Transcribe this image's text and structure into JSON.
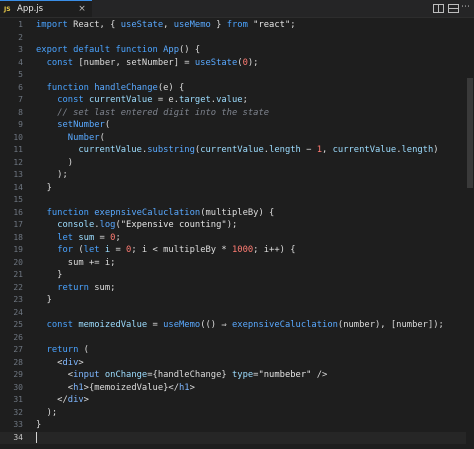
{
  "tab": {
    "icon_text": "JS",
    "filename": "App.js",
    "close": "×",
    "more": "⋯"
  },
  "lines": [
    [
      {
        "c": "kw",
        "t": "import"
      },
      {
        "c": "punc",
        "t": " React, { "
      },
      {
        "c": "fn",
        "t": "useState"
      },
      {
        "c": "punc",
        "t": ", "
      },
      {
        "c": "fn",
        "t": "useMemo"
      },
      {
        "c": "punc",
        "t": " } "
      },
      {
        "c": "kw",
        "t": "from"
      },
      {
        "c": "str",
        "t": " \"react\""
      },
      {
        "c": "punc",
        "t": ";"
      }
    ],
    [],
    [
      {
        "c": "kw",
        "t": "export default function"
      },
      {
        "c": "fn",
        "t": " App"
      },
      {
        "c": "punc",
        "t": "() {"
      }
    ],
    [
      {
        "c": "punc",
        "t": "  "
      },
      {
        "c": "kw",
        "t": "const"
      },
      {
        "c": "punc",
        "t": " [number, setNumber] = "
      },
      {
        "c": "fn",
        "t": "useState"
      },
      {
        "c": "punc",
        "t": "("
      },
      {
        "c": "num",
        "t": "0"
      },
      {
        "c": "punc",
        "t": ");"
      }
    ],
    [],
    [
      {
        "c": "punc",
        "t": "  "
      },
      {
        "c": "kw",
        "t": "function"
      },
      {
        "c": "fn",
        "t": " handleChange"
      },
      {
        "c": "punc",
        "t": "(e) {"
      }
    ],
    [
      {
        "c": "punc",
        "t": "    "
      },
      {
        "c": "kw",
        "t": "const"
      },
      {
        "c": "var",
        "t": " currentValue"
      },
      {
        "c": "punc",
        "t": " = e."
      },
      {
        "c": "var",
        "t": "target"
      },
      {
        "c": "punc",
        "t": "."
      },
      {
        "c": "var",
        "t": "value"
      },
      {
        "c": "punc",
        "t": ";"
      }
    ],
    [
      {
        "c": "punc",
        "t": "    "
      },
      {
        "c": "com",
        "t": "// set last entered digit into the state"
      }
    ],
    [
      {
        "c": "punc",
        "t": "    "
      },
      {
        "c": "fn",
        "t": "setNumber"
      },
      {
        "c": "punc",
        "t": "("
      }
    ],
    [
      {
        "c": "punc",
        "t": "      "
      },
      {
        "c": "fn",
        "t": "Number"
      },
      {
        "c": "punc",
        "t": "("
      }
    ],
    [
      {
        "c": "punc",
        "t": "        "
      },
      {
        "c": "var",
        "t": "currentValue"
      },
      {
        "c": "punc",
        "t": "."
      },
      {
        "c": "fn",
        "t": "substring"
      },
      {
        "c": "punc",
        "t": "("
      },
      {
        "c": "var",
        "t": "currentValue"
      },
      {
        "c": "punc",
        "t": "."
      },
      {
        "c": "var",
        "t": "length"
      },
      {
        "c": "punc",
        "t": " − "
      },
      {
        "c": "num",
        "t": "1"
      },
      {
        "c": "punc",
        "t": ", "
      },
      {
        "c": "var",
        "t": "currentValue"
      },
      {
        "c": "punc",
        "t": "."
      },
      {
        "c": "var",
        "t": "length"
      },
      {
        "c": "punc",
        "t": ")"
      }
    ],
    [
      {
        "c": "punc",
        "t": "      )"
      }
    ],
    [
      {
        "c": "punc",
        "t": "    );"
      }
    ],
    [
      {
        "c": "punc",
        "t": "  }"
      }
    ],
    [],
    [
      {
        "c": "punc",
        "t": "  "
      },
      {
        "c": "kw",
        "t": "function"
      },
      {
        "c": "fn",
        "t": " exepnsiveCaluclation"
      },
      {
        "c": "punc",
        "t": "(multipleBy) {"
      }
    ],
    [
      {
        "c": "punc",
        "t": "    "
      },
      {
        "c": "var",
        "t": "console"
      },
      {
        "c": "punc",
        "t": "."
      },
      {
        "c": "fn",
        "t": "log"
      },
      {
        "c": "punc",
        "t": "("
      },
      {
        "c": "str",
        "t": "\"Expensive counting\""
      },
      {
        "c": "punc",
        "t": ");"
      }
    ],
    [
      {
        "c": "punc",
        "t": "    "
      },
      {
        "c": "kw",
        "t": "let"
      },
      {
        "c": "var",
        "t": " sum"
      },
      {
        "c": "punc",
        "t": " = "
      },
      {
        "c": "num",
        "t": "0"
      },
      {
        "c": "punc",
        "t": ";"
      }
    ],
    [
      {
        "c": "punc",
        "t": "    "
      },
      {
        "c": "kw",
        "t": "for"
      },
      {
        "c": "punc",
        "t": " ("
      },
      {
        "c": "kw",
        "t": "let"
      },
      {
        "c": "var",
        "t": " i"
      },
      {
        "c": "punc",
        "t": " = "
      },
      {
        "c": "num",
        "t": "0"
      },
      {
        "c": "punc",
        "t": "; i < multipleBy * "
      },
      {
        "c": "num",
        "t": "1000"
      },
      {
        "c": "punc",
        "t": "; i++) {"
      }
    ],
    [
      {
        "c": "punc",
        "t": "      sum += i;"
      }
    ],
    [
      {
        "c": "punc",
        "t": "    }"
      }
    ],
    [
      {
        "c": "punc",
        "t": "    "
      },
      {
        "c": "kw",
        "t": "return"
      },
      {
        "c": "punc",
        "t": " sum;"
      }
    ],
    [
      {
        "c": "punc",
        "t": "  }"
      }
    ],
    [],
    [
      {
        "c": "punc",
        "t": "  "
      },
      {
        "c": "kw",
        "t": "const"
      },
      {
        "c": "var",
        "t": " memoizedValue"
      },
      {
        "c": "punc",
        "t": " = "
      },
      {
        "c": "fn",
        "t": "useMemo"
      },
      {
        "c": "punc",
        "t": "(() ⇒ "
      },
      {
        "c": "fn",
        "t": "exepnsiveCaluclation"
      },
      {
        "c": "punc",
        "t": "(number), [number]);"
      }
    ],
    [],
    [
      {
        "c": "punc",
        "t": "  "
      },
      {
        "c": "kw",
        "t": "return"
      },
      {
        "c": "punc",
        "t": " ("
      }
    ],
    [
      {
        "c": "punc",
        "t": "    <"
      },
      {
        "c": "tag",
        "t": "div"
      },
      {
        "c": "punc",
        "t": ">"
      }
    ],
    [
      {
        "c": "punc",
        "t": "      <"
      },
      {
        "c": "tag",
        "t": "input"
      },
      {
        "c": "attr",
        "t": " onChange"
      },
      {
        "c": "punc",
        "t": "={handleChange} "
      },
      {
        "c": "attr",
        "t": "type"
      },
      {
        "c": "punc",
        "t": "="
      },
      {
        "c": "str",
        "t": "\"numbeber\""
      },
      {
        "c": "punc",
        "t": " />"
      }
    ],
    [
      {
        "c": "punc",
        "t": "      <"
      },
      {
        "c": "tag",
        "t": "h1"
      },
      {
        "c": "punc",
        "t": ">{memoizedValue}</"
      },
      {
        "c": "tag",
        "t": "h1"
      },
      {
        "c": "punc",
        "t": ">"
      }
    ],
    [
      {
        "c": "punc",
        "t": "    </"
      },
      {
        "c": "tag",
        "t": "div"
      },
      {
        "c": "punc",
        "t": ">"
      }
    ],
    [
      {
        "c": "punc",
        "t": "  );"
      }
    ],
    [
      {
        "c": "punc",
        "t": "}"
      }
    ],
    []
  ],
  "current_line": 34
}
